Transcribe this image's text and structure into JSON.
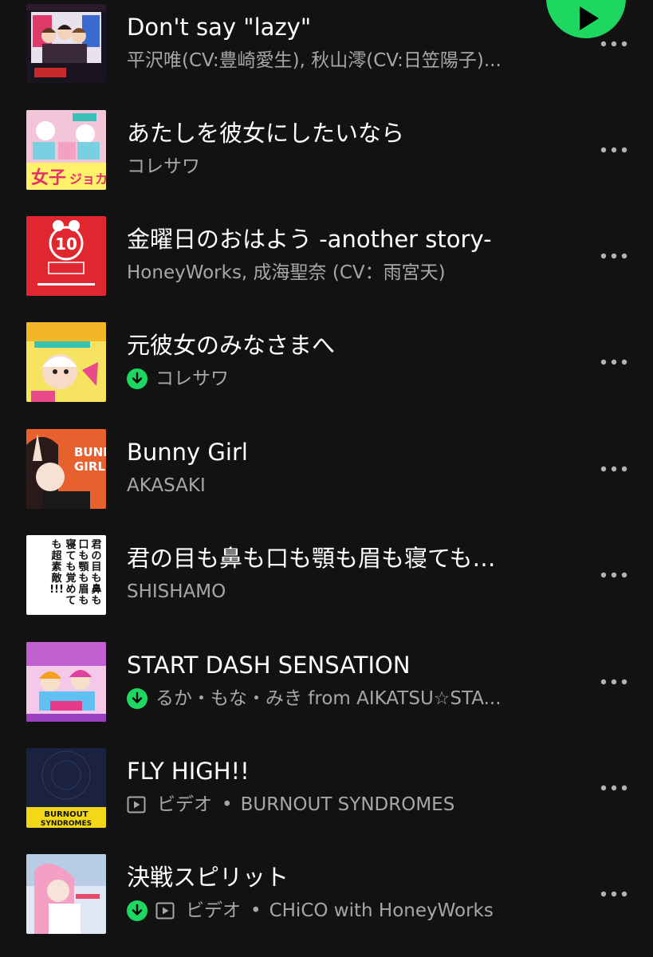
{
  "theme": {
    "background": "#121212",
    "text_primary": "#ffffff",
    "text_secondary": "#a7a7a7",
    "accent_green": "#1ed760"
  },
  "play_button": {
    "icon": "play-icon",
    "color": "#1ed760"
  },
  "tracks": [
    {
      "title": "Don't say \"lazy\"",
      "artist": "平沢唯(CV:豊崎愛生), 秋山澪(CV:日笠陽子)...",
      "downloaded": false,
      "video": false,
      "art": "k-on-band-cover"
    },
    {
      "title": "あたしを彼女にしたいなら",
      "artist": "コレサワ",
      "downloaded": false,
      "video": false,
      "art": "joshi-joka-cover"
    },
    {
      "title": "金曜日のおはよう -another story-",
      "artist": "HoneyWorks, 成海聖奈 (CV：雨宮天)",
      "downloaded": false,
      "video": false,
      "art": "honeyworks-10th-cover"
    },
    {
      "title": "元彼女のみなさまへ",
      "artist": "コレサワ",
      "downloaded": true,
      "video": false,
      "art": "motokanojo-cover"
    },
    {
      "title": "Bunny Girl",
      "artist": "AKASAKI",
      "downloaded": false,
      "video": false,
      "art": "bunny-girl-cover"
    },
    {
      "title": "君の目も鼻も口も顎も眉も寝ても…",
      "artist": "SHISHAMO",
      "downloaded": false,
      "video": false,
      "art": "shishamo-text-cover"
    },
    {
      "title": "START DASH SENSATION",
      "artist": "るか・もな・みき from AIKATSU☆STA...",
      "downloaded": true,
      "video": false,
      "art": "aikatsu-cover"
    },
    {
      "title": "FLY HIGH!!",
      "artist": "BURNOUT SYNDROMES",
      "downloaded": false,
      "video": true,
      "type_label": "ビデオ",
      "separator": "•",
      "art": "burnout-syndromes-cover"
    },
    {
      "title": "決戦スピリット",
      "artist": "CHiCO with HoneyWorks",
      "downloaded": true,
      "video": true,
      "type_label": "ビデオ",
      "separator": "•",
      "art": "chico-honeyworks-cover"
    }
  ],
  "icons": {
    "more": "more-dots-icon",
    "download": "downloaded-icon",
    "video": "video-icon"
  }
}
